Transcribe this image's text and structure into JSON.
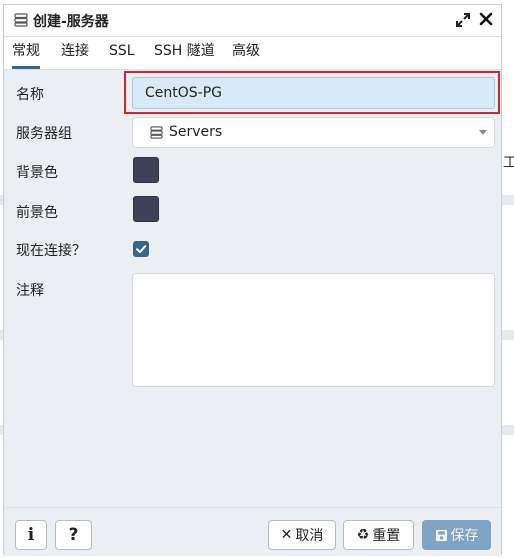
{
  "dialog": {
    "title": "创建-服务器",
    "tabs": [
      {
        "label": "常规",
        "active": true
      },
      {
        "label": "连接",
        "active": false
      },
      {
        "label": "SSL",
        "active": false
      },
      {
        "label": "SSH 隧道",
        "active": false
      },
      {
        "label": "高级",
        "active": false
      }
    ],
    "form": {
      "name_label": "名称",
      "name_value": "CentOS-PG",
      "group_label": "服务器组",
      "group_value": "Servers",
      "bg_color_label": "背景色",
      "bg_color": "#3f4159",
      "fg_color_label": "前景色",
      "fg_color": "#3f4159",
      "connect_now_label": "现在连接？",
      "connect_now_checked": true,
      "comment_label": "注释",
      "comment_value": ""
    },
    "footer": {
      "info_label": "i",
      "help_label": "?",
      "cancel_label": "取消",
      "reset_label": "重置",
      "save_label": "保存"
    }
  },
  "background": {
    "peek_char": "工"
  },
  "colors": {
    "accent": "#326690",
    "highlight_border": "#d6242a",
    "name_field_bg": "#d5ebf7",
    "save_button_bg": "#7fa3c2"
  }
}
